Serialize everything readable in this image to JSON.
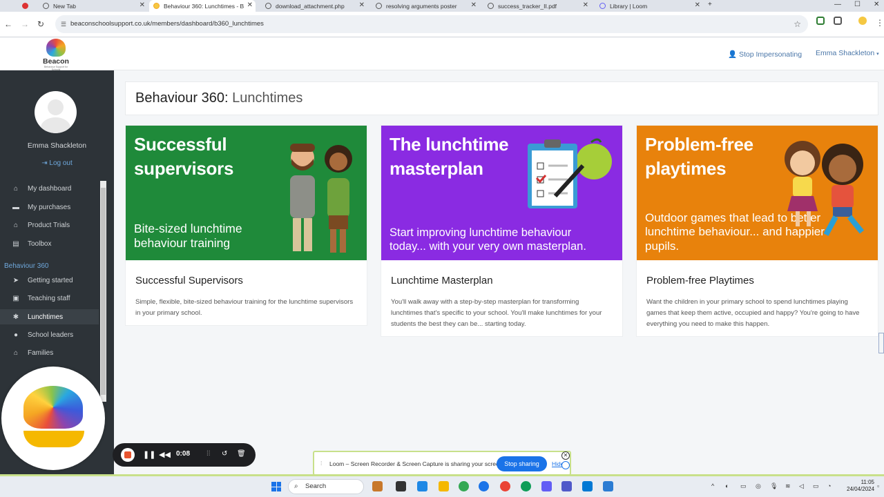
{
  "browser": {
    "tabs": [
      {
        "title": "New Tab",
        "active": false
      },
      {
        "title": "Behaviour 360: Lunchtimes - B",
        "active": true
      },
      {
        "title": "download_attachment.php",
        "active": false
      },
      {
        "title": "resolving arguments poster",
        "active": false
      },
      {
        "title": "success_tracker_II.pdf",
        "active": false
      },
      {
        "title": "Library | Loom",
        "active": false
      }
    ],
    "url": "beaconschoolsupport.co.uk/members/dashboard/b360_lunchtimes"
  },
  "header": {
    "logo_text": "Beacon",
    "logo_subtext": "Behaviour Support for Schools",
    "stop_impersonating": "Stop Impersonating",
    "user_name": "Emma Shackleton"
  },
  "sidebar": {
    "user_name": "Emma Shackleton",
    "logout": "Log out",
    "items": [
      {
        "label": "My dashboard",
        "icon": "home-icon"
      },
      {
        "label": "My purchases",
        "icon": "money-icon"
      },
      {
        "label": "Product Trials",
        "icon": "bank-icon"
      },
      {
        "label": "Toolbox",
        "icon": "toolbox-icon"
      }
    ],
    "section_title": "Behaviour 360",
    "section_items": [
      {
        "label": "Getting started",
        "icon": "paper-plane-icon"
      },
      {
        "label": "Teaching staff",
        "icon": "chalkboard-icon"
      },
      {
        "label": "Lunchtimes",
        "icon": "cutlery-icon",
        "active": true
      },
      {
        "label": "School leaders",
        "icon": "user-icon"
      },
      {
        "label": "Families",
        "icon": "home-icon"
      }
    ]
  },
  "main": {
    "title_prefix": "Behaviour 360:",
    "title_suffix": "Lunchtimes",
    "cards": [
      {
        "banner_heading": "Successful supervisors",
        "banner_sub": "Bite-sized lunchtime behaviour training",
        "banner_color": "#1f8a3a",
        "title": "Successful Supervisors",
        "description": "Simple, flexible, bite-sized behaviour training for the lunchtime supervisors in your primary school."
      },
      {
        "banner_heading": "The lunchtime masterplan",
        "banner_sub": "Start improving lunchtime behaviour today... with your very own masterplan.",
        "banner_color": "#8a2be2",
        "title": "Lunchtime Masterplan",
        "description": "You'll walk away with a step-by-step masterplan for transforming lunchtimes that's specific to your school. You'll make lunchtimes for your students the best they can be... starting today."
      },
      {
        "banner_heading": "Problem-free playtimes",
        "banner_sub": "Outdoor games that lead to better lunchtime behaviour... and happier pupils.",
        "banner_color": "#e8820c",
        "title": "Problem-free Playtimes",
        "description": "Want the children in your primary school to spend lunchtimes playing games that keep them active, occupied and happy? You're going to have everything you need to make this happen."
      }
    ]
  },
  "recorder": {
    "timer": "0:08"
  },
  "loom_share": {
    "message": "Loom – Screen Recorder & Screen Capture is sharing your screen.",
    "stop_sharing": "Stop sharing",
    "hide": "Hide"
  },
  "taskbar": {
    "search_placeholder": "Search",
    "time": "11:05",
    "date": "24/04/2024"
  }
}
